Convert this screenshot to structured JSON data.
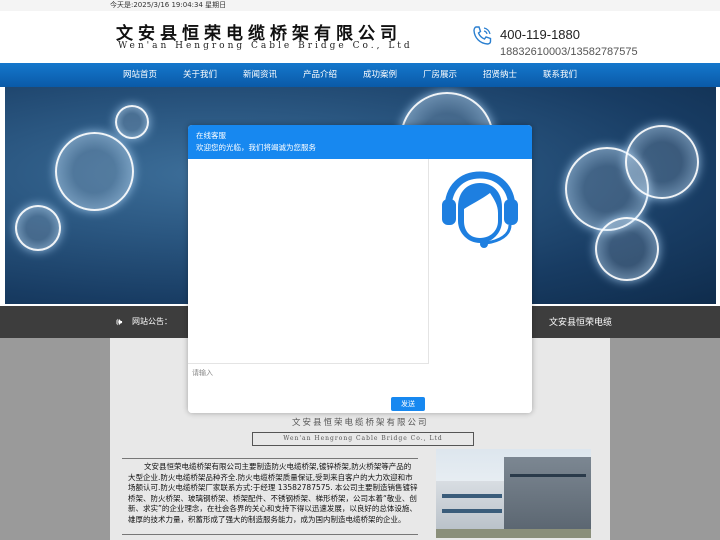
{
  "topbar": {
    "date_text": "今天是:2025/3/16 19:04:34 星期日"
  },
  "header": {
    "company_cn": "文安县恒荣电缆桥架有限公司",
    "company_en": "Wen'an Hengrong Cable Bridge Co., Ltd",
    "hotline": "400-119-1880",
    "mobiles": "18832610003/13582787575",
    "phone_icon": "phone-icon"
  },
  "nav": {
    "items": [
      {
        "label": "网站首页"
      },
      {
        "label": "关于我们"
      },
      {
        "label": "新闻资讯"
      },
      {
        "label": "产品介绍"
      },
      {
        "label": "成功案例"
      },
      {
        "label": "厂房展示"
      },
      {
        "label": "招贤纳士"
      },
      {
        "label": "联系我们"
      }
    ]
  },
  "notice": {
    "icon": "speaker-icon",
    "label": "网站公告：",
    "scroll_text": "文安县恒荣电缆"
  },
  "about": {
    "company_cn": "文安县恒荣电缆桥架有限公司",
    "company_en": "Wen'an Hengrong Cable Bridge Co., Ltd",
    "text": "文安县恒荣电缆桥架有限公司主要制造防火电缆桥架,镀锌桥架,防火桥架等产品的大型企业.防火电缆桥架品种齐全.防火电缆桥架质量保证,受到来自客户的大力欢迎和市场额认可.防火电缆桥架厂家联系方式:于经理 13582787575. 本公司主要制造销售镀锌桥架、防火桥架、玻璃钢桥架、桥架配件、不锈钢桥架、梯形桥架，公司本着“敬业、创新、求实”的企业理念，在社会各界的关心和支持下得以迅速发展，以良好的总体设施、雄厚的技术力量，积蓄形成了强大的制造服务能力，成为国内制造电缆桥架的企业。"
  },
  "chat": {
    "title": "在线客服",
    "welcome": "欢迎您的光临，我们将竭诚为您服务",
    "input_placeholder": "请输入",
    "send_label": "发送",
    "accent": "#1788f0",
    "agent_icon": "customer-service-icon"
  }
}
